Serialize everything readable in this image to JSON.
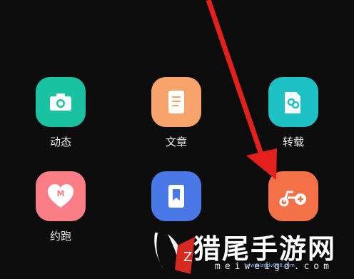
{
  "apps": [
    {
      "name": "app-moments",
      "label": "动态",
      "color": "#19c2a0",
      "icon": "camera-icon"
    },
    {
      "name": "app-article",
      "label": "文章",
      "color": "#f7a36b",
      "icon": "document-icon"
    },
    {
      "name": "app-repost",
      "label": "转载",
      "color": "#1ec2c4",
      "icon": "link-document-icon"
    },
    {
      "name": "app-run",
      "label": "约跑",
      "color": "#fb7e86",
      "icon": "heart-m-icon"
    },
    {
      "name": "app-bookmark",
      "label": "",
      "color": "#4a78e6",
      "icon": "bookmark-icon"
    },
    {
      "name": "app-ride",
      "label": "",
      "color": "#f47046",
      "icon": "scooter-plus-icon"
    }
  ],
  "watermark": {
    "text": "猎尾手游网",
    "url": "meiweigd.com",
    "small": "www.lzgdv888.com"
  },
  "arrow_color": "#e3201b"
}
